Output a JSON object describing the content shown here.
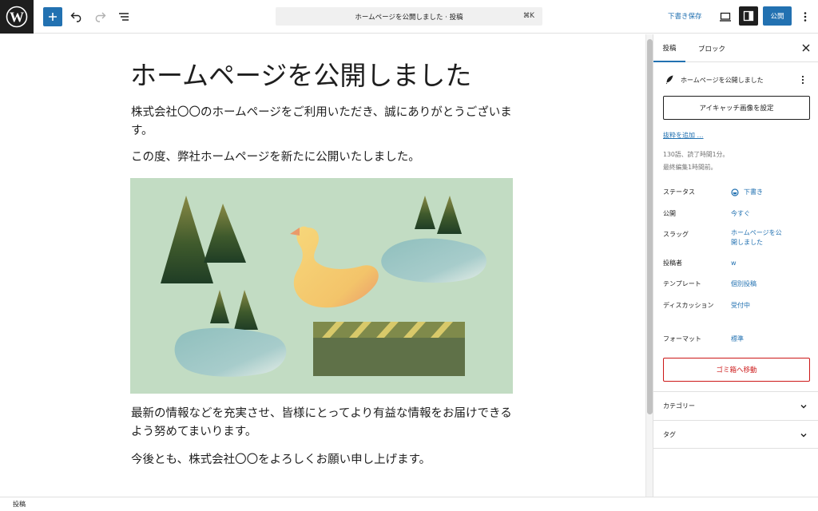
{
  "topbar": {
    "command_title": "ホームページを公開しました · 投稿",
    "command_shortcut": "⌘K",
    "save_draft": "下書き保存",
    "publish": "公開"
  },
  "post": {
    "title": "ホームページを公開しました",
    "paragraphs": [
      "株式会社〇〇のホームページをご利用いただき、誠にありがとうございます。",
      "この度、弊社ホームページを新たに公開いたしました。",
      "最新の情報などを充実させ、皆様にとってより有益な情報をお届けできるよう努めてまいります。",
      "今後とも、株式会社〇〇をよろしくお願い申し上げます。"
    ]
  },
  "sidebar": {
    "tabs": [
      "投稿",
      "ブロック"
    ],
    "summary_title": "ホームページを公開しました",
    "featured_image_button": "アイキャッチ画像を設定",
    "add_excerpt": "抜粋を追加 …",
    "word_count": "130語、読了時間1分。",
    "last_edited": "最終編集1時間前。",
    "rows": [
      {
        "label": "ステータス",
        "value": "下書き"
      },
      {
        "label": "公開",
        "value": "今すぐ"
      },
      {
        "label": "スラッグ",
        "value": "ホームページを公開しました"
      },
      {
        "label": "投稿者",
        "value": "w"
      },
      {
        "label": "テンプレート",
        "value": "個別投稿"
      },
      {
        "label": "ディスカッション",
        "value": "受付中"
      },
      {
        "label": "フォーマット",
        "value": "標準"
      }
    ],
    "trash_button": "ゴミ箱へ移動",
    "panels": [
      "カテゴリー",
      "タグ"
    ]
  },
  "footer": {
    "breadcrumb": "投稿"
  },
  "colors": {
    "accent": "#2271b1",
    "danger": "#cc1818",
    "dark": "#1e1e1e"
  }
}
